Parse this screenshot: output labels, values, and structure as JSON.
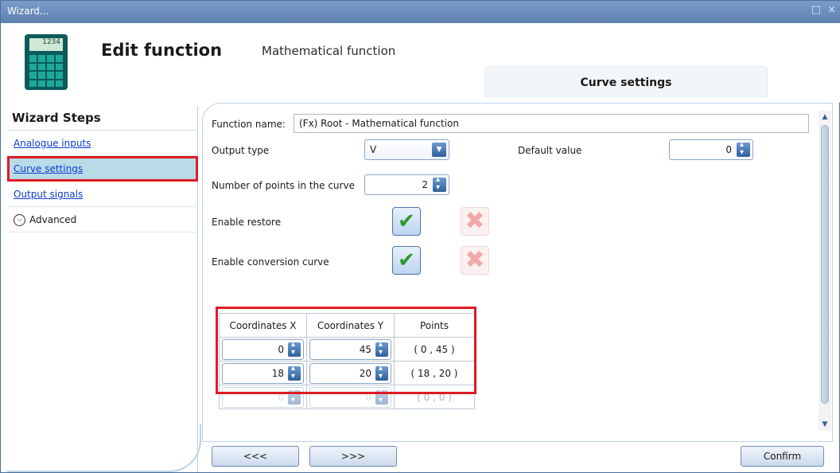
{
  "window": {
    "title": "Wizard...",
    "controls": "□ ×"
  },
  "header": {
    "calc_display": "1234",
    "title": "Edit function",
    "subtitle": "Mathematical function",
    "active_tab": "Curve settings"
  },
  "steps": {
    "heading": "Wizard Steps",
    "items": [
      {
        "label": "Analogue inputs"
      },
      {
        "label": "Curve settings"
      },
      {
        "label": "Output signals"
      },
      {
        "label": "Advanced"
      }
    ]
  },
  "form": {
    "function_name_label": "Function name:",
    "function_name_value": "(Fx) Root - Mathematical function",
    "output_type_label": "Output type",
    "output_type_value": "V",
    "default_value_label": "Default value",
    "default_value": "0",
    "num_points_label": "Number of points in the curve",
    "num_points_value": "2",
    "enable_restore_label": "Enable restore",
    "enable_conversion_label": "Enable conversion curve",
    "check_glyph": "✔",
    "cross_glyph": "✖"
  },
  "table": {
    "headers": [
      "Coordinates X",
      "Coordinates Y",
      "Points"
    ],
    "rows": [
      {
        "x": "0",
        "y": "45",
        "point": "( 0 , 45 )"
      },
      {
        "x": "18",
        "y": "20",
        "point": "( 18 , 20 )"
      },
      {
        "x": "0",
        "y": "0",
        "point": "( 0 , 0 )"
      }
    ]
  },
  "scroll": {
    "up": "▲",
    "down": "▼"
  },
  "footer": {
    "back_label": "<<<",
    "next_label": ">>>",
    "confirm_label": "Confirm"
  }
}
